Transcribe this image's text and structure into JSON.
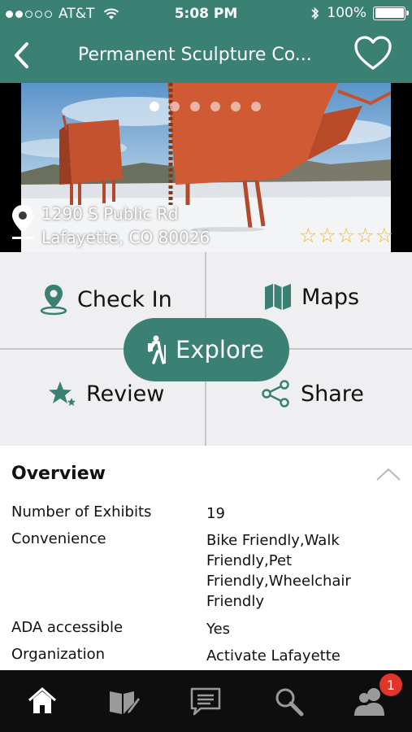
{
  "status_bar": {
    "carrier": "AT&T",
    "time": "5:08 PM",
    "battery": "100%",
    "signal_bars": 2
  },
  "header": {
    "title": "Permanent Sculpture Co..."
  },
  "hero": {
    "page_count": 6,
    "active_page": 1,
    "address_line1": "1290 S Public Rd",
    "address_line2": "Lafayette, CO 80026",
    "rating": 0,
    "rating_max": 5
  },
  "actions": {
    "check_in": "Check In",
    "maps": "Maps",
    "explore": "Explore",
    "review": "Review",
    "share": "Share"
  },
  "overview": {
    "title": "Overview",
    "rows": [
      {
        "label": "Number of Exhibits",
        "value": "19"
      },
      {
        "label": "Convenience",
        "value": "Bike Friendly,Walk Friendly,Pet Friendly,Wheelchair Friendly"
      },
      {
        "label": "ADA accessible",
        "value": "Yes"
      },
      {
        "label": "Organization",
        "value": "Activate Lafayette"
      }
    ]
  },
  "tabbar": {
    "items": [
      "home-icon",
      "guide-book-icon",
      "messages-icon",
      "search-icon",
      "friends-icon"
    ],
    "badge": "1"
  },
  "colors": {
    "brand": "#3a8073",
    "star": "#f1b924",
    "badge": "#e0352b"
  }
}
